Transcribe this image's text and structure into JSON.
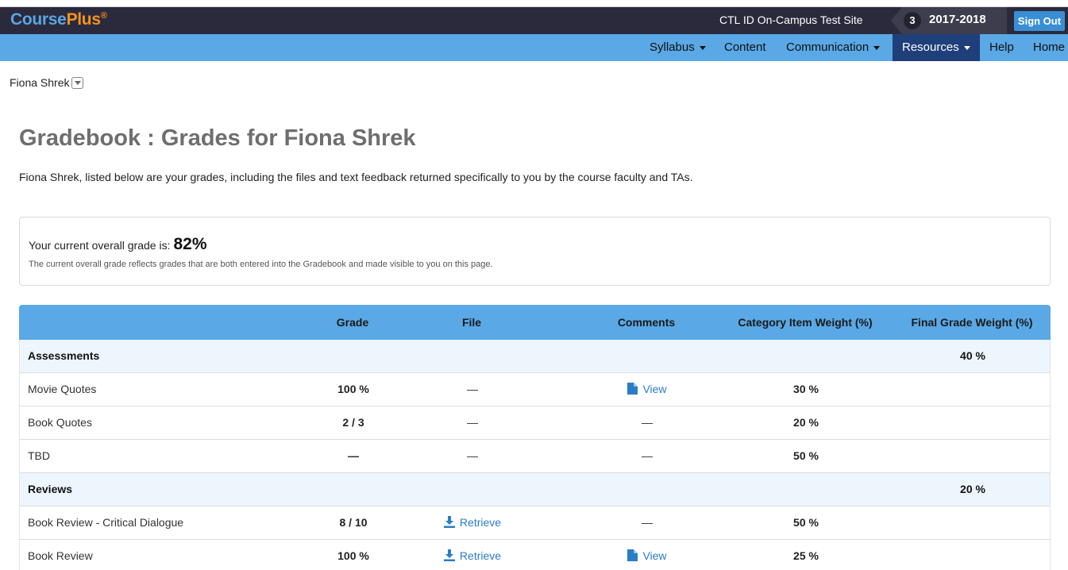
{
  "app": {
    "brand_main": "Course",
    "brand_plus": "Plus",
    "brand_mark": "®",
    "site_name": "CTL ID On-Campus Test Site",
    "term_number": "3",
    "term_year": "2017-2018",
    "sign_out": "Sign Out"
  },
  "nav": {
    "syllabus": "Syllabus",
    "content": "Content",
    "communication": "Communication",
    "resources": "Resources",
    "help": "Help",
    "home": "Home"
  },
  "user_select": {
    "label": "Fiona Shrek"
  },
  "page": {
    "title": "Gradebook : Grades for Fiona Shrek",
    "intro": "Fiona Shrek, listed below are your grades, including the files and text feedback returned specifically to you by the course faculty and TAs."
  },
  "overall": {
    "label": "Your current overall grade is:",
    "value": "82%",
    "note": "The current overall grade reflects grades that are both entered into the Gradebook and made visible to you on this page."
  },
  "table": {
    "headers": {
      "grade": "Grade",
      "file": "File",
      "comments": "Comments",
      "category_item_weight": "Category Item Weight (%)",
      "final_grade_weight": "Final Grade Weight (%)"
    },
    "rows": [
      {
        "type": "category",
        "name": "Assessments",
        "final_weight": "40 %"
      },
      {
        "type": "item",
        "name": "Movie Quotes",
        "grade": "100 %",
        "file": "—",
        "comments": "View",
        "weight": "30 %"
      },
      {
        "type": "item",
        "name": "Book Quotes",
        "grade": "2 / 3",
        "file": "—",
        "comments": "—",
        "weight": "20 %"
      },
      {
        "type": "item",
        "name": "TBD",
        "grade": "—",
        "file": "—",
        "comments": "—",
        "weight": "50 %"
      },
      {
        "type": "category",
        "name": "Reviews",
        "final_weight": "20 %"
      },
      {
        "type": "item",
        "name": "Book Review - Critical Dialogue",
        "grade": "8 / 10",
        "file": "Retrieve",
        "comments": "—",
        "weight": "50 %"
      },
      {
        "type": "item",
        "name": "Book Review",
        "grade": "100 %",
        "file": "Retrieve",
        "comments": "View",
        "weight": "25 %"
      }
    ]
  },
  "colors": {
    "topbar": "#2a2a3c",
    "nav": "#5aa8e5",
    "nav_active": "#1f3f7a",
    "link": "#2a7dc7",
    "category_row": "#edf5fd"
  },
  "icons": {
    "view": "document-icon",
    "retrieve": "download-icon",
    "user_dropdown": "chevron-down-icon"
  }
}
